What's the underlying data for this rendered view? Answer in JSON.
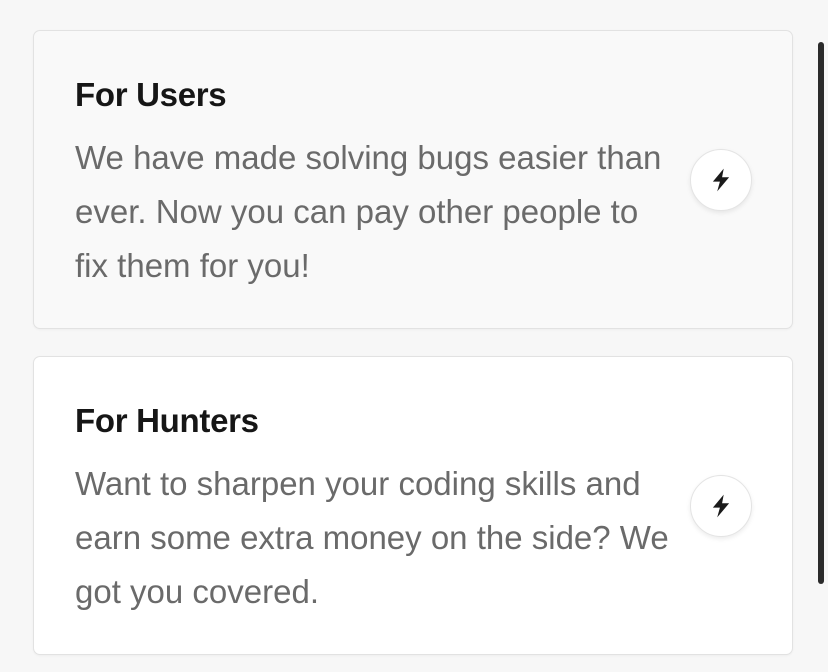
{
  "cards": [
    {
      "title": "For Users",
      "description": "We have made solving bugs easier than ever. Now you can pay other people to fix them for you!",
      "action_icon": "lightning-bolt-icon"
    },
    {
      "title": "For Hunters",
      "description": "Want to sharpen your coding skills and earn some extra money on the side? We got you covered.",
      "action_icon": "lightning-bolt-icon"
    }
  ],
  "colors": {
    "page_background": "#f7f7f7",
    "title_text": "#161616",
    "body_text": "#6a6a6a",
    "scrollbar": "#2b2b2b"
  }
}
